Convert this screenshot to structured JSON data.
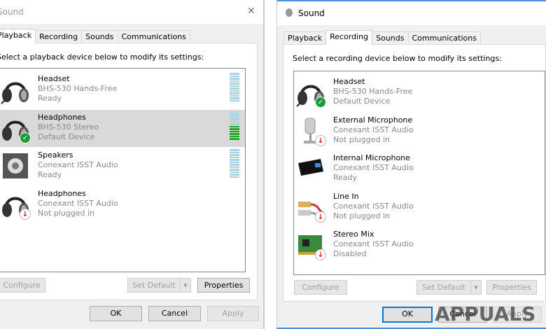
{
  "left": {
    "title": "Sound",
    "close": "✕",
    "tabs": [
      "Playback",
      "Recording",
      "Sounds",
      "Communications"
    ],
    "active_tab": 0,
    "instruction": "Select a playback device below to modify its settings:",
    "devices": [
      {
        "name": "Headset",
        "driver": "BHS-530 Hands-Free",
        "status": "Ready",
        "icon": "headset-icon",
        "badge": "",
        "level": 0
      },
      {
        "name": "Headphones",
        "driver": "BHS-530 Stereo",
        "status": "Default Device",
        "icon": "headphones-icon",
        "badge": "check",
        "level": 0.5,
        "selected": true
      },
      {
        "name": "Speakers",
        "driver": "Conexant ISST Audio",
        "status": "Ready",
        "icon": "speaker-icon",
        "badge": "",
        "level": 0
      },
      {
        "name": "Headphones",
        "driver": "Conexant ISST Audio",
        "status": "Not plugged in",
        "icon": "headphones-icon",
        "badge": "down",
        "level": null
      }
    ],
    "buttons": {
      "configure": "Configure",
      "set_default": "Set Default",
      "properties": "Properties",
      "ok": "OK",
      "cancel": "Cancel",
      "apply": "Apply"
    }
  },
  "right": {
    "title": "Sound",
    "tabs": [
      "Playback",
      "Recording",
      "Sounds",
      "Communications"
    ],
    "active_tab": 1,
    "instruction": "Select a recording device below to modify its settings:",
    "devices": [
      {
        "name": "Headset",
        "driver": "BHS-530 Hands-Free",
        "status": "Default Device",
        "icon": "headset-icon",
        "badge": "check"
      },
      {
        "name": "External Microphone",
        "driver": "Conexant ISST Audio",
        "status": "Not plugged in",
        "icon": "microphone-icon",
        "badge": "down"
      },
      {
        "name": "Internal Microphone",
        "driver": "Conexant ISST Audio",
        "status": "Ready",
        "icon": "webcam-mic-icon",
        "badge": ""
      },
      {
        "name": "Line In",
        "driver": "Conexant ISST Audio",
        "status": "Not plugged in",
        "icon": "line-in-icon",
        "badge": "down"
      },
      {
        "name": "Stereo Mix",
        "driver": "Conexant ISST Audio",
        "status": "Disabled",
        "icon": "sound-card-icon",
        "badge": "down"
      }
    ],
    "buttons": {
      "configure": "Configure",
      "set_default": "Set Default",
      "properties": "Properties",
      "ok": "OK",
      "cancel": "Cancel",
      "apply": "Apply"
    }
  },
  "watermark": "APPUALS",
  "colors": {
    "accent": "#0078d7",
    "selected": "#d9d9d9",
    "meter_idle": "#a9d3de",
    "meter_active": "#27a52b"
  }
}
